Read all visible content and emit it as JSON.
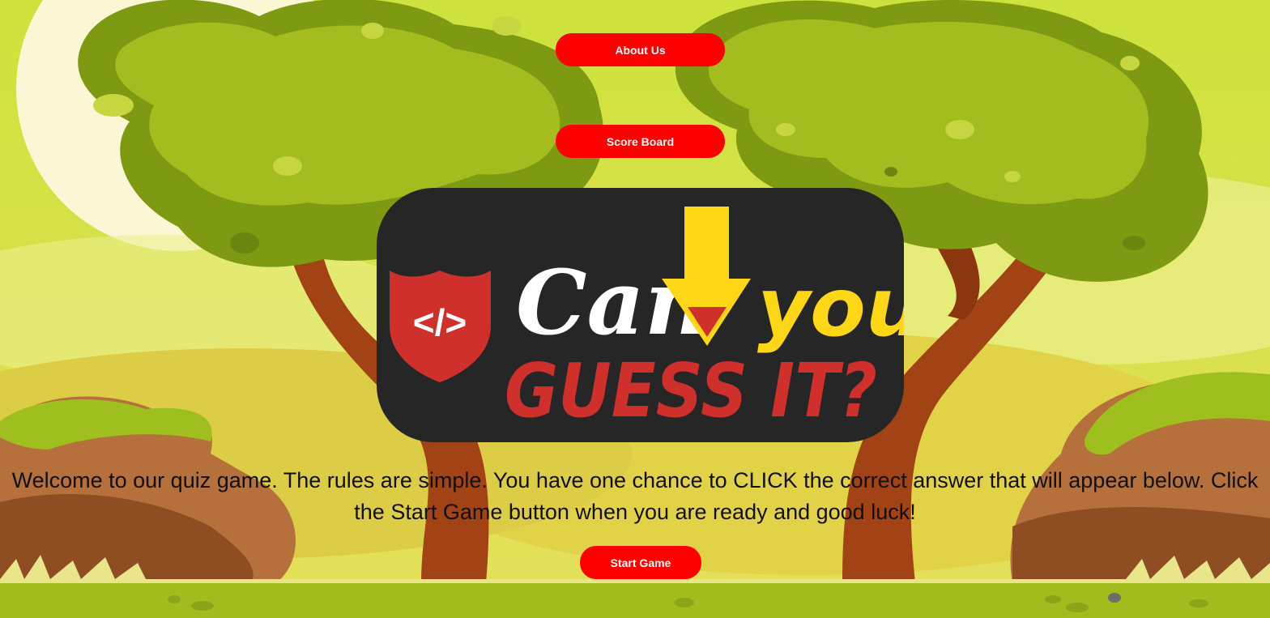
{
  "nav": {
    "about_label": "About Us",
    "scoreboard_label": "Score Board"
  },
  "logo": {
    "line1_a": "Can",
    "line1_b": "you",
    "line2": "GUESS IT?",
    "code_symbol": "</>"
  },
  "intro": {
    "text": "Welcome to our quiz game. The rules are simple. You have one chance to CLICK the correct answer that will appear below. Click the Start Game button when you are ready and good luck!"
  },
  "actions": {
    "start_label": "Start Game"
  },
  "colors": {
    "button": "#ff0000",
    "logo_bg": "#262626",
    "logo_red": "#d0302c",
    "logo_yellow": "#fdd616"
  }
}
